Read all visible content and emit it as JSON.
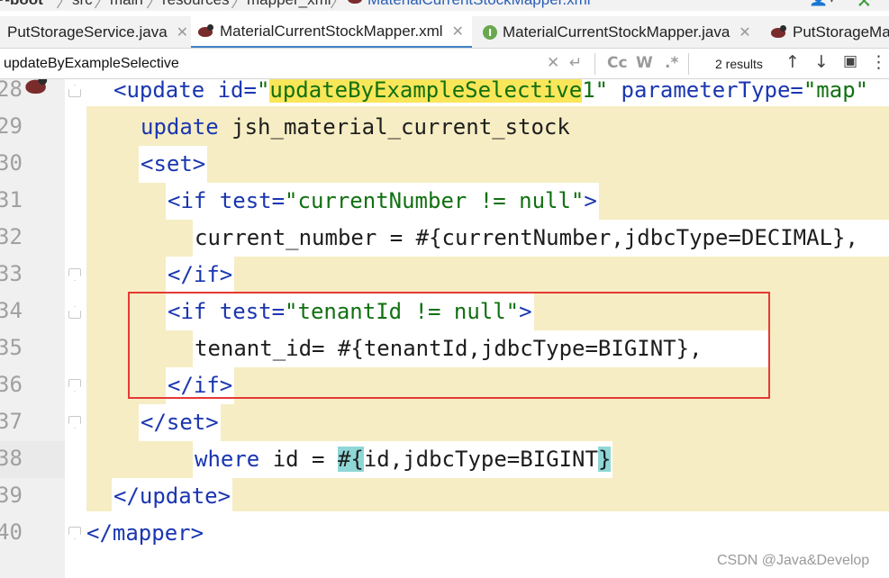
{
  "breadcrumb": {
    "items": [
      "P-boot",
      "src",
      "main",
      "resources",
      "mapper_xml",
      "MaterialCurrentStockMapper.xml"
    ]
  },
  "tabs": [
    {
      "label": "PutStorageService.java",
      "icon": "java-class-icon",
      "active": false
    },
    {
      "label": "MaterialCurrentStockMapper.xml",
      "icon": "mybatis-bird-icon",
      "active": true
    },
    {
      "label": "MaterialCurrentStockMapper.java",
      "icon": "java-interface-icon",
      "active": false
    },
    {
      "label": "PutStorageMa",
      "icon": "mybatis-bird-icon",
      "active": false
    }
  ],
  "search": {
    "value": "updateByExampleSelective",
    "results": "2 results",
    "match_case": "Cc",
    "words": "W",
    "regex": ".*"
  },
  "editor": {
    "line_numbers": [
      "28",
      "29",
      "30",
      "31",
      "32",
      "33",
      "34",
      "35",
      "36",
      "37",
      "38",
      "39",
      "40"
    ],
    "lines": {
      "l28": {
        "p1": "<update ",
        "p2": "id=",
        "p3": "\"",
        "p4": "updateByExampleSelective",
        "p5": "1\" ",
        "p6": "parameterType=",
        "p7": "\"map\""
      },
      "l29": {
        "p1": "update",
        "p2": " jsh_material_current_stock"
      },
      "l30": {
        "p1": "<set>"
      },
      "l31": {
        "p1": "<if ",
        "p2": "test=",
        "p3": "\"currentNumber != null\"",
        "p4": ">"
      },
      "l32": {
        "p1": "current_number = #{currentNumber,jdbcType=DECIMAL},"
      },
      "l33": {
        "p1": "</if>"
      },
      "l34": {
        "p1": "<if ",
        "p2": "test=",
        "p3": "\"tenantId != null\"",
        "p4": ">"
      },
      "l35": {
        "p1": "tenant_id= #{tenantId,jdbcType=BIGINT},"
      },
      "l36": {
        "p1": "</if>"
      },
      "l37": {
        "p1": "</set>"
      },
      "l38": {
        "p1": "where",
        "p2": " id = ",
        "p3": "#{",
        "p4": "id,jdbcType=BIGINT",
        "p5": "}"
      },
      "l39": {
        "p1": "</update>"
      },
      "l40": {
        "p1": "</mapper>"
      }
    }
  },
  "watermark": "CSDN @Java&Develop",
  "colors": {
    "tag": "#1a36b0",
    "string": "#117011",
    "search_highlight": "#f9e659",
    "brace_match": "#8fd6d6",
    "scope_highlight": "#f6edc4",
    "annotation_box": "#e53935"
  }
}
